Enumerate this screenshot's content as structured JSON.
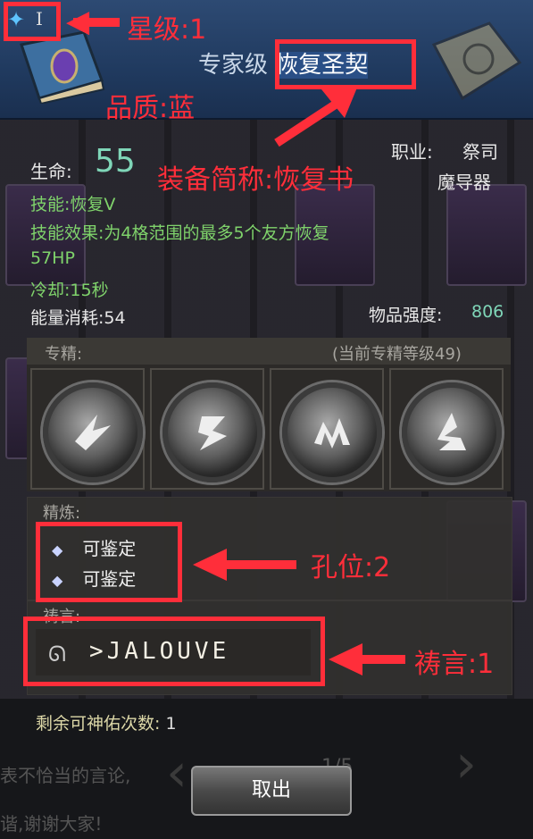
{
  "header": {
    "star_icon": "blue-star-icon",
    "tier": "I",
    "title_prefix": "专家级",
    "title_main": "恢复圣契"
  },
  "stats": {
    "life_label": "生命:",
    "life_value": "55",
    "class_label": "职业:",
    "class_value1": "祭司",
    "class_value2": "魔导器",
    "skill": "技能:恢复V",
    "skill_effect_line1": "技能效果:为4格范围的最多5个友方恢复",
    "skill_effect_line2": "57HP",
    "cooldown": "冷却:15秒",
    "energy": "能量消耗:54",
    "strength_label": "物品强度:",
    "strength_value": "806"
  },
  "specialization": {
    "label": "专精:",
    "level_note": "(当前专精等级49)"
  },
  "refine": {
    "label": "精炼:",
    "sockets": [
      "可鉴定",
      "可鉴定"
    ]
  },
  "prayer": {
    "label": "祷言:",
    "value": ">JALOUVE"
  },
  "footer": {
    "remaining_label": "剩余可神佑次数:",
    "remaining_value": "1",
    "cancel": "取出",
    "page": "1/5",
    "bg_text1": "表不恰当的言论,",
    "bg_text2": "谐,谢谢大家!"
  },
  "annotations": {
    "star": "星级:1",
    "quality": "品质:蓝",
    "short_name": "装备简称:恢复书",
    "sockets": "孔位:2",
    "prayer": "祷言:1"
  },
  "colors": {
    "annotation": "#ff2e3a",
    "header_bg": "#2d4a73",
    "skill_text": "#7fd36b",
    "life_value": "#7fd6b8"
  }
}
